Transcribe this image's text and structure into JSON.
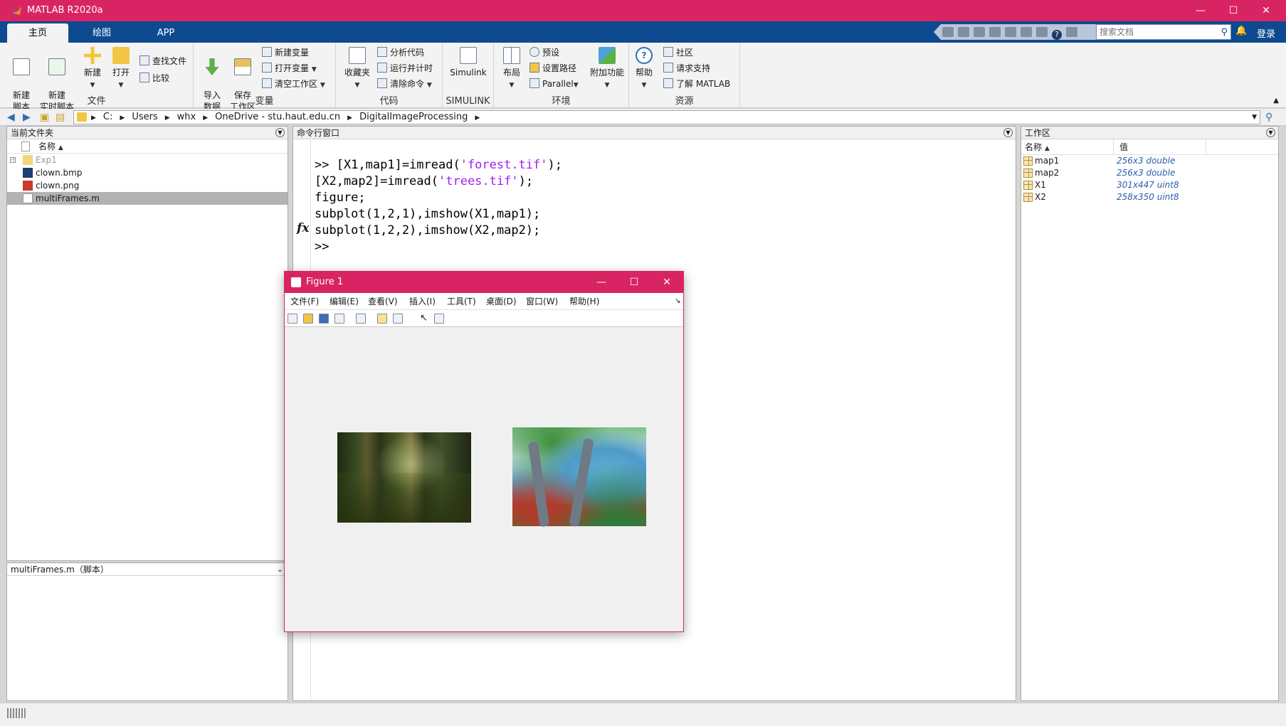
{
  "window": {
    "title": "MATLAB R2020a",
    "minimize": "—",
    "maximize": "☐",
    "close": "✕"
  },
  "tabs": [
    "主页",
    "绘图",
    "APP"
  ],
  "search": {
    "placeholder": "搜索文档"
  },
  "account": {
    "login": "登录"
  },
  "ribbon": {
    "file_group": {
      "label": "文件",
      "new_script": "新建\n脚本",
      "new_live_script": "新建\n实时脚本",
      "new": "新建",
      "open": "打开",
      "find_files": "查找文件",
      "compare": "比较"
    },
    "variable_group": {
      "label": "变量",
      "import_data": "导入\n数据",
      "save_workspace": "保存\n工作区",
      "new_variable": "新建变量",
      "open_variable": "打开变量",
      "clear_workspace": "清空工作区"
    },
    "code_group": {
      "label": "代码",
      "favorites": "收藏夹",
      "analyze_code": "分析代码",
      "run_and_time": "运行并计时",
      "clear_commands": "清除命令"
    },
    "simulink_group": {
      "label": "SIMULINK",
      "simulink": "Simulink"
    },
    "environment_group": {
      "label": "环境",
      "layout": "布局",
      "preferences": "预设",
      "set_path": "设置路径",
      "parallel": "Parallel",
      "add_ons": "附加功能"
    },
    "resources_group": {
      "label": "资源",
      "help": "帮助",
      "community": "社区",
      "request_support": "请求支持",
      "learn_matlab": "了解 MATLAB"
    }
  },
  "address": {
    "segments": [
      "C:",
      "Users",
      "whx",
      "OneDrive - stu.haut.edu.cn",
      "DigitalImageProcessing"
    ]
  },
  "current_folder": {
    "title": "当前文件夹",
    "column_name": "名称",
    "files": [
      {
        "name": "Exp1",
        "type": "folder"
      },
      {
        "name": "clown.bmp",
        "type": "bmp"
      },
      {
        "name": "clown.png",
        "type": "png"
      },
      {
        "name": "multiFrames.m",
        "type": "m",
        "selected": true
      }
    ],
    "details_title": "multiFrames.m（脚本）"
  },
  "command_window": {
    "title": "命令行窗口",
    "prompt_line": ">> ",
    "lines": [
      [
        ">> [X1,map1]=imread(",
        "'forest.tif'",
        ");"
      ],
      [
        "[X2,map2]=imread(",
        "'trees.tif'",
        ");"
      ],
      [
        "figure;"
      ],
      [
        "subplot(1,2,1),imshow(X1,map1);"
      ],
      [
        "subplot(1,2,2),imshow(X2,map2);"
      ]
    ],
    "fx": "fx",
    "final_prompt": ">>"
  },
  "workspace": {
    "title": "工作区",
    "col_name": "名称",
    "col_value": "值",
    "vars": [
      {
        "name": "map1",
        "value": "256x3 double"
      },
      {
        "name": "map2",
        "value": "256x3 double"
      },
      {
        "name": "X1",
        "value": "301x447 uint8"
      },
      {
        "name": "X2",
        "value": "258x350 uint8"
      }
    ]
  },
  "figure": {
    "title": "Figure 1",
    "menu": [
      "文件(F)",
      "编辑(E)",
      "查看(V)",
      "插入(I)",
      "工具(T)",
      "桌面(D)",
      "窗口(W)",
      "帮助(H)"
    ]
  },
  "colors": {
    "accent": "#d92463",
    "tabbar": "#0d4a8f",
    "string": "#a020f0"
  }
}
